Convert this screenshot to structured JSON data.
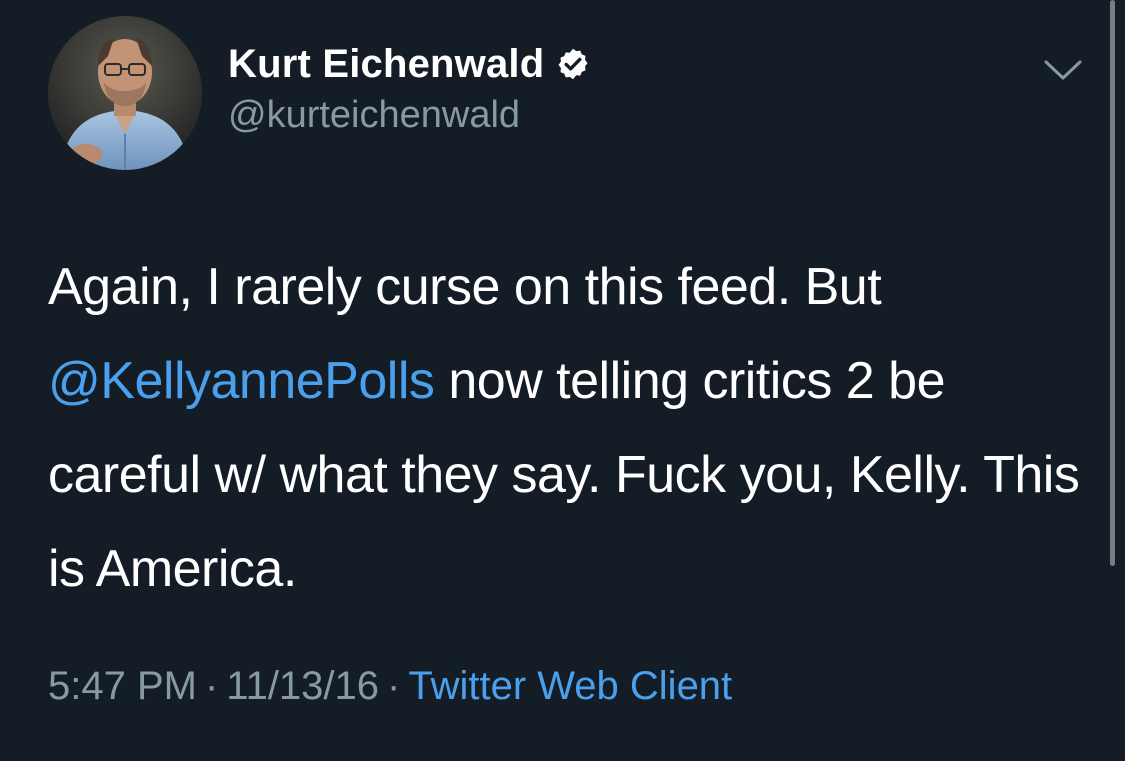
{
  "tweet": {
    "author": {
      "display_name": "Kurt Eichenwald",
      "handle": "@kurteichenwald",
      "verified": true,
      "avatar_icon": "profile-photo"
    },
    "menu_icon": "chevron-down-icon",
    "text_before_mention": "Again, I rarely curse on this feed. But ",
    "mention": "@KellyannePolls",
    "text_after_mention": " now telling critics 2 be careful w/ what they say. Fuck you, Kelly. This is America.",
    "time": "5:47 PM",
    "date": "11/13/16",
    "separator": "·",
    "source": "Twitter Web Client"
  },
  "colors": {
    "background": "#141d26",
    "text": "#ffffff",
    "secondary_text": "#8899a6",
    "link": "#4aa0ec"
  }
}
